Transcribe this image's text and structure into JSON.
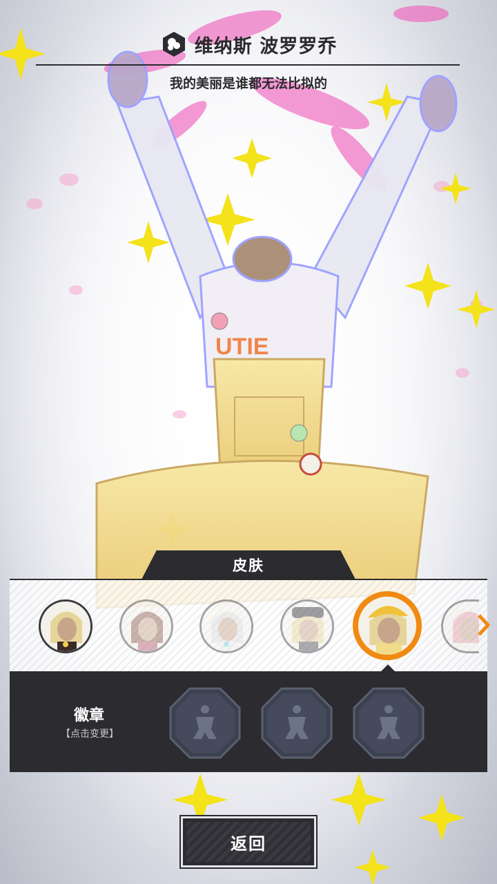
{
  "header": {
    "character_name": "维纳斯 波罗罗乔",
    "quote": "我的美丽是谁都无法比拟的"
  },
  "skin_panel": {
    "tab_label": "皮肤",
    "skins": [
      {
        "state": "owned"
      },
      {
        "state": "locked"
      },
      {
        "state": "locked"
      },
      {
        "state": "locked"
      },
      {
        "state": "selected"
      },
      {
        "state": "locked-partial"
      }
    ],
    "accent_color": "#f08a12"
  },
  "badge_panel": {
    "title": "徽章",
    "hint": "【点击变更】",
    "slots": [
      {
        "icon": "badge-silhouette-icon"
      },
      {
        "icon": "badge-silhouette-icon"
      },
      {
        "icon": "badge-silhouette-icon"
      }
    ]
  },
  "back_button": {
    "label": "返回"
  },
  "colors": {
    "panel_dark": "#2b2b30",
    "selected_ring": "#f08a12",
    "overall_yellow": "#f1dc8a"
  }
}
